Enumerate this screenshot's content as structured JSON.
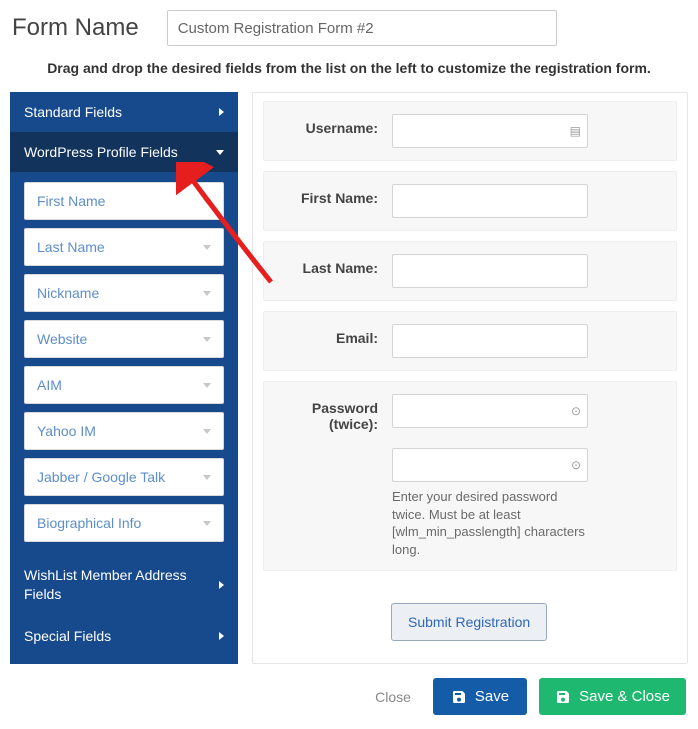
{
  "header": {
    "title_label": "Form Name",
    "form_name_value": "Custom Registration Form #2"
  },
  "instruction": "Drag and drop the desired fields from the list on the left to customize the registration form.",
  "sidebar": {
    "sections": [
      {
        "label": "Standard Fields",
        "expanded": false
      },
      {
        "label": "WordPress Profile Fields",
        "expanded": true
      },
      {
        "label": "WishList Member Address Fields",
        "expanded": false
      },
      {
        "label": "Special Fields",
        "expanded": false
      }
    ],
    "wp_fields": [
      {
        "label": "First Name"
      },
      {
        "label": "Last Name"
      },
      {
        "label": "Nickname"
      },
      {
        "label": "Website"
      },
      {
        "label": "AIM"
      },
      {
        "label": "Yahoo IM"
      },
      {
        "label": "Jabber / Google Talk"
      },
      {
        "label": "Biographical Info"
      }
    ]
  },
  "canvas": {
    "fields": [
      {
        "label": "Username:"
      },
      {
        "label": "First Name:"
      },
      {
        "label": "Last Name:"
      },
      {
        "label": "Email:"
      },
      {
        "label": "Password (twice):"
      }
    ],
    "password_help": "Enter your desired password twice. Must be at least [wlm_min_passlength] characters long.",
    "submit_label": "Submit Registration"
  },
  "footer": {
    "close_label": "Close",
    "save_label": "Save",
    "save_close_label": "Save & Close"
  }
}
